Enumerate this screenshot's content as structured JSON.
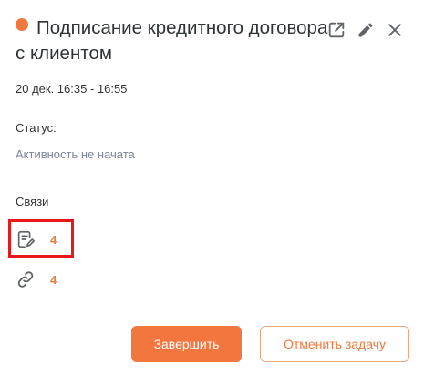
{
  "task": {
    "title": "Подписание кредитного договора с клиентом",
    "time_range": "20 дек. 16:35 - 16:55",
    "status_label": "Статус:",
    "status_value": "Активность не начата",
    "status_dot_color": "#f07a3e"
  },
  "header_icons": [
    "open-in-new-icon",
    "pencil-icon",
    "close-icon"
  ],
  "relations": {
    "label": "Связи",
    "items": [
      {
        "icon": "note-edit-icon",
        "count": "4"
      },
      {
        "icon": "link-icon",
        "count": "4"
      }
    ]
  },
  "actions": {
    "finish_label": "Завершить",
    "cancel_label": "Отменить задачу"
  },
  "colors": {
    "accent": "#f07a3e",
    "highlight": "#e8171a",
    "muted_text": "#7b8696"
  }
}
